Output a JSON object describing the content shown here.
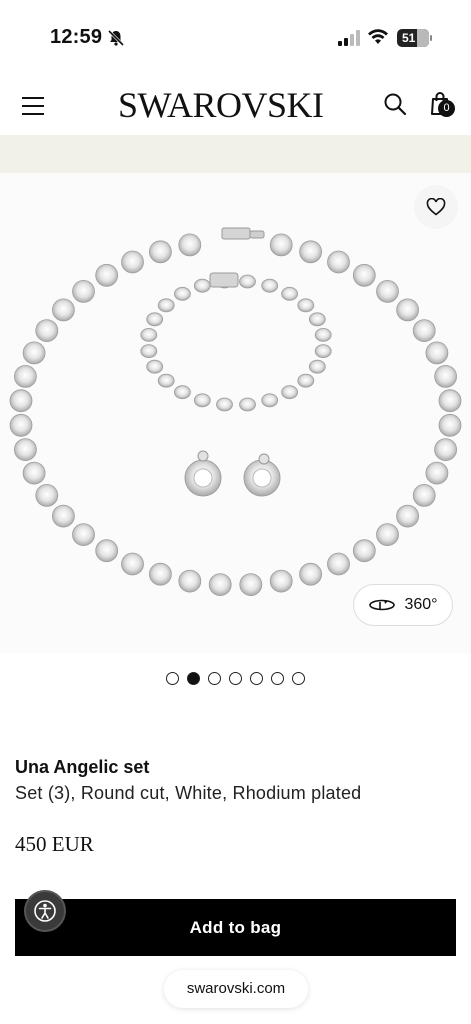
{
  "status_bar": {
    "time": "12:59",
    "battery": "51"
  },
  "header": {
    "logo": "SWAROVSKI",
    "bag_count": "0"
  },
  "product": {
    "view_360_label": "360°",
    "carousel": {
      "total": 7,
      "active_index": 1
    },
    "name": "Una Angelic set",
    "description": "Set (3), Round cut, White, Rhodium plated",
    "price": "450 EUR",
    "add_to_bag_label": "Add to bag"
  },
  "browser": {
    "url": "swarovski.com"
  },
  "icons": {
    "menu": "hamburger-icon",
    "search": "search-icon",
    "bag": "shopping-bag-icon",
    "wishlist": "heart-icon",
    "rotate": "rotate-360-icon",
    "accessibility": "accessibility-icon"
  },
  "colors": {
    "promo_strip": "#f1f1e9",
    "button_bg": "#000000",
    "text": "#111111"
  }
}
